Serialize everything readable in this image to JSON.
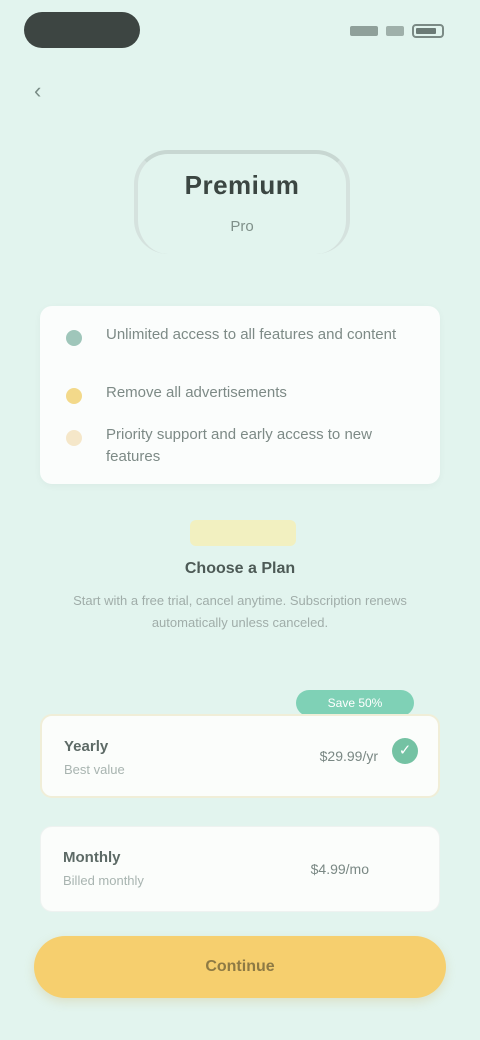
{
  "status_bar": {
    "icons": [
      "signal-icon",
      "wifi-icon",
      "battery-icon"
    ]
  },
  "header": {
    "back_icon": "chevron-left-icon",
    "back_glyph": "‹"
  },
  "hero": {
    "title": "Premium",
    "subtitle": "Pro"
  },
  "features": [
    {
      "icon": "check-icon",
      "color": "#9fc6ba",
      "text": "Unlimited access to all features and content"
    },
    {
      "icon": "star-icon",
      "color": "#f3d98a",
      "text": "Remove all advertisements"
    },
    {
      "icon": "sparkle-icon",
      "color": "#f5e7c9",
      "text": "Priority support and early access to new features"
    }
  ],
  "offer": {
    "title": "Choose a Plan",
    "description": "Start with a free trial, cancel anytime. Subscription renews automatically unless canceled."
  },
  "plans": [
    {
      "name": "Yearly",
      "subtitle": "Best value",
      "price": "$29.99/yr",
      "selected": true,
      "badge": "Save 50%"
    },
    {
      "name": "Monthly",
      "subtitle": "Billed monthly",
      "price": "$4.99/mo",
      "selected": false
    }
  ],
  "cta": {
    "label": "Continue"
  },
  "colors": {
    "background": "#e2f4ee",
    "accent": "#74c2a3",
    "cta": "#f6cf6e"
  }
}
